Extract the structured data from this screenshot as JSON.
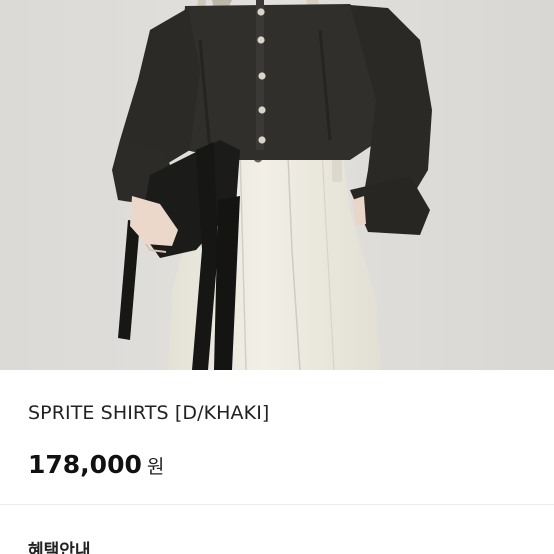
{
  "product": {
    "name": "SPRITE SHIRTS [D/KHAKI]",
    "price": "178,000",
    "currency_label": "원",
    "benefits_heading": "혜택안내"
  },
  "colors": {
    "background": "#dedcda",
    "shirt": "#2f2e2a",
    "pants": "#ebe8dc",
    "bag": "#1b1b1a",
    "text": "#222222"
  }
}
